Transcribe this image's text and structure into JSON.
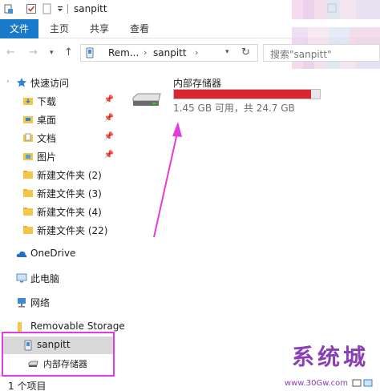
{
  "window": {
    "title": "sanpitt"
  },
  "ribbon": {
    "tabs": [
      "文件",
      "主页",
      "共享",
      "查看"
    ]
  },
  "address": {
    "segments": [
      "Rem...",
      "sanpitt"
    ],
    "search_placeholder": "搜索\"sanpitt\""
  },
  "sidebar": {
    "quick_access": "快速访问",
    "quick_items": [
      "下载",
      "桌面",
      "文档",
      "图片",
      "新建文件夹 (2)",
      "新建文件夹 (3)",
      "新建文件夹 (4)",
      "新建文件夹 (22)"
    ],
    "onedrive": "OneDrive",
    "this_pc": "此电脑",
    "network": "网络",
    "removable": "Removable Storage",
    "device": "sanpitt",
    "device_child": "内部存储器"
  },
  "main": {
    "drive_name": "内部存储器",
    "drive_info": "1.45 GB 可用，共 24.7 GB",
    "used_fraction": 0.941
  },
  "status": {
    "items": "1 个项目"
  },
  "watermark": {
    "text": "系统城",
    "url": "www.30Gw.com"
  },
  "colors": {
    "accent": "#1979ca",
    "highlight": "#e23ce0",
    "bar": "#da2630"
  }
}
